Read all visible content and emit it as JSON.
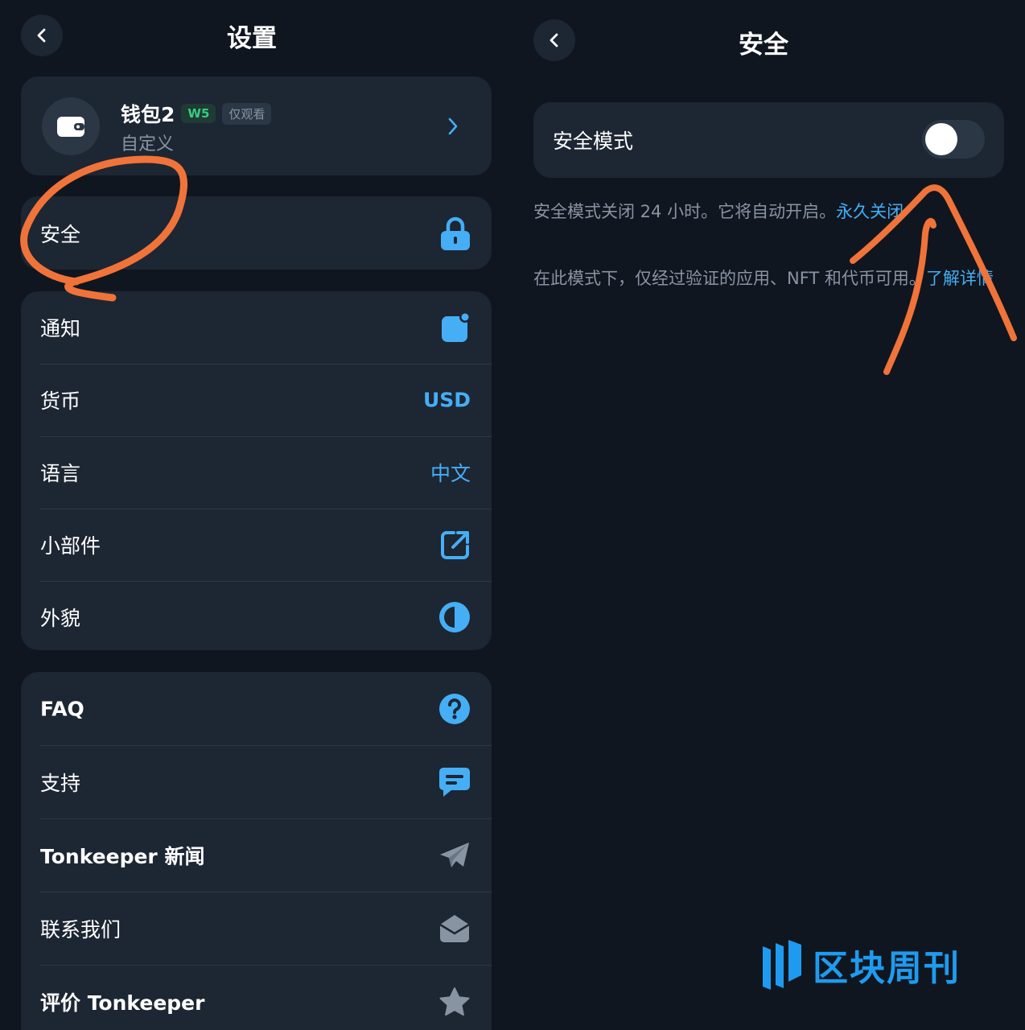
{
  "left_panel": {
    "title": "设置",
    "wallet": {
      "name": "钱包2",
      "version_badge": "W5",
      "watch_badge": "仅观看",
      "type": "自定义"
    },
    "security_row": {
      "label": "安全",
      "icon": "lock-icon"
    },
    "preferences": [
      {
        "label": "通知",
        "icon": "notification-icon"
      },
      {
        "label": "货币",
        "value": "USD"
      },
      {
        "label": "语言",
        "value": "中文"
      },
      {
        "label": "小部件",
        "icon": "external-link-icon"
      },
      {
        "label": "外貌",
        "icon": "appearance-icon"
      }
    ],
    "help": [
      {
        "label": "FAQ",
        "icon": "question-icon"
      },
      {
        "label": "支持",
        "icon": "chat-icon"
      },
      {
        "label": "Tonkeeper 新闻",
        "icon": "telegram-icon"
      },
      {
        "label": "联系我们",
        "icon": "mail-icon"
      },
      {
        "label": "评价 Tonkeeper",
        "icon": "star-icon"
      }
    ]
  },
  "right_panel": {
    "title": "安全",
    "safe_mode": {
      "label": "安全模式",
      "enabled": false
    },
    "notice": {
      "text": "安全模式关闭 24 小时。它将自动开启。",
      "link": "永久关闭"
    },
    "info": {
      "text": "在此模式下，仅经过验证的应用、NFT 和代币可用。",
      "link": "了解详情"
    }
  },
  "watermark": {
    "text": "区块周刊"
  },
  "colors": {
    "background": "#10161f",
    "card": "#1d2633",
    "accent": "#45aef5",
    "secondary_text": "#8994a3",
    "annotation": "#f0733a"
  }
}
